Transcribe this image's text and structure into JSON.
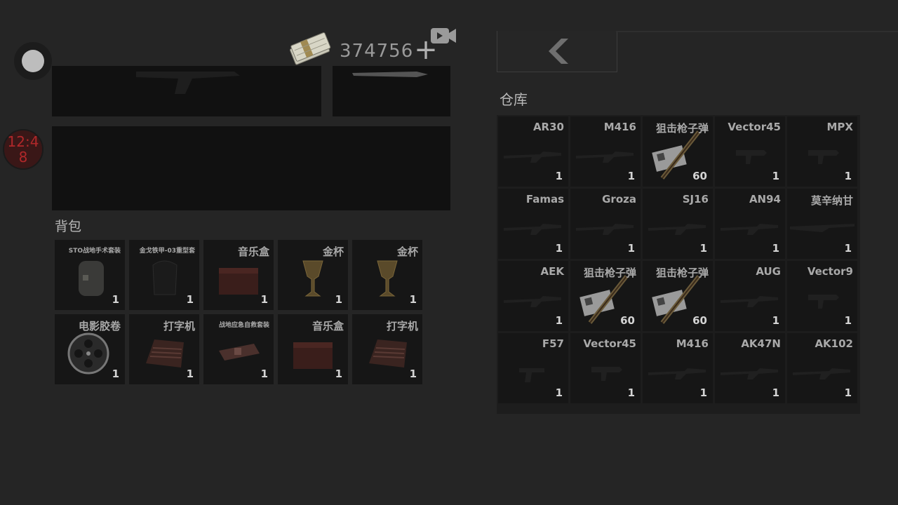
{
  "hud": {
    "money": "374756",
    "timer": "12:48"
  },
  "icons": {
    "menu": "circle-menu-icon",
    "money": "cash-stack-icon",
    "add": "plus-icon",
    "video": "video-ad-icon",
    "back": "chevron-left-icon"
  },
  "bag": {
    "label": "背包",
    "items": [
      {
        "name": "STO战地手术套装",
        "count": "1",
        "icon": "surgery-kit-icon",
        "small": true
      },
      {
        "name": "金戈铁甲-03重型套",
        "count": "1",
        "icon": "armor-icon",
        "small": true
      },
      {
        "name": "音乐盒",
        "count": "1",
        "icon": "music-box-icon",
        "small": false
      },
      {
        "name": "金杯",
        "count": "1",
        "icon": "gold-cup-icon",
        "small": false
      },
      {
        "name": "金杯",
        "count": "1",
        "icon": "gold-cup-icon",
        "small": false
      },
      {
        "name": "电影胶卷",
        "count": "1",
        "icon": "film-reel-icon",
        "small": false
      },
      {
        "name": "打字机",
        "count": "1",
        "icon": "typewriter-icon",
        "small": false
      },
      {
        "name": "战地应急自救套装",
        "count": "1",
        "icon": "first-aid-kit-icon",
        "small": true
      },
      {
        "name": "音乐盒",
        "count": "1",
        "icon": "music-box-icon",
        "small": false
      },
      {
        "name": "打字机",
        "count": "1",
        "icon": "typewriter-icon",
        "small": false
      }
    ]
  },
  "warehouse": {
    "label": "仓库",
    "items": [
      {
        "name": "AR30",
        "count": "1",
        "icon": "rifle-icon"
      },
      {
        "name": "M416",
        "count": "1",
        "icon": "rifle-icon"
      },
      {
        "name": "狙击枪子弹",
        "count": "60",
        "icon": "sniper-ammo-icon"
      },
      {
        "name": "Vector45",
        "count": "1",
        "icon": "smg-icon"
      },
      {
        "name": "MPX",
        "count": "1",
        "icon": "smg-icon"
      },
      {
        "name": "Famas",
        "count": "1",
        "icon": "rifle-icon"
      },
      {
        "name": "Groza",
        "count": "1",
        "icon": "rifle-icon"
      },
      {
        "name": "SJ16",
        "count": "1",
        "icon": "rifle-icon"
      },
      {
        "name": "AN94",
        "count": "1",
        "icon": "rifle-icon"
      },
      {
        "name": "莫辛纳甘",
        "count": "1",
        "icon": "sniper-rifle-icon"
      },
      {
        "name": "AEK",
        "count": "1",
        "icon": "rifle-icon"
      },
      {
        "name": "狙击枪子弹",
        "count": "60",
        "icon": "sniper-ammo-icon"
      },
      {
        "name": "狙击枪子弹",
        "count": "60",
        "icon": "sniper-ammo-icon"
      },
      {
        "name": "AUG",
        "count": "1",
        "icon": "rifle-icon"
      },
      {
        "name": "Vector9",
        "count": "1",
        "icon": "smg-icon"
      },
      {
        "name": "F57",
        "count": "1",
        "icon": "pistol-icon"
      },
      {
        "name": "Vector45",
        "count": "1",
        "icon": "smg-icon"
      },
      {
        "name": "M416",
        "count": "1",
        "icon": "rifle-icon"
      },
      {
        "name": "AK47N",
        "count": "1",
        "icon": "rifle-icon"
      },
      {
        "name": "AK102",
        "count": "1",
        "icon": "rifle-icon"
      }
    ]
  }
}
